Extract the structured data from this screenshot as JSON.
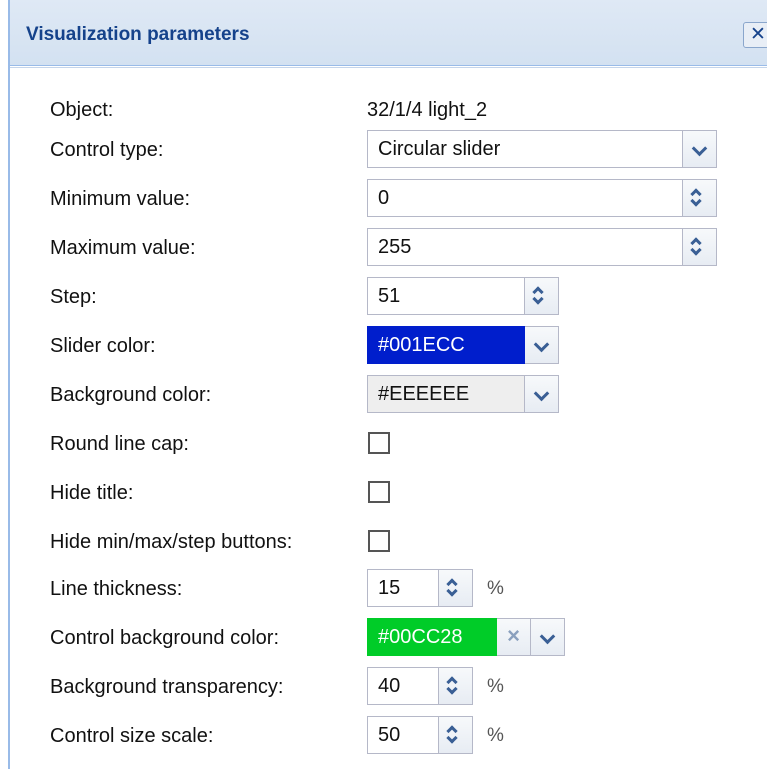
{
  "dialog": {
    "title": "Visualization parameters",
    "close_icon": "close-icon"
  },
  "colors": {
    "title_bar_bg": "#d3e1f1",
    "title_text": "#15428b",
    "slider_color": "#001ECC",
    "background_color": "#EEEEEE",
    "control_background_color": "#00CC28"
  },
  "fields": {
    "object": {
      "label": "Object:",
      "value": "32/1/4 light_2"
    },
    "control_type": {
      "label": "Control type:",
      "value": "Circular slider"
    },
    "minimum_value": {
      "label": "Minimum value:",
      "value": "0"
    },
    "maximum_value": {
      "label": "Maximum value:",
      "value": "255"
    },
    "step": {
      "label": "Step:",
      "value": "51"
    },
    "slider_color": {
      "label": "Slider color:",
      "value": "#001ECC"
    },
    "background_color": {
      "label": "Background color:",
      "value": "#EEEEEE"
    },
    "round_line_cap": {
      "label": "Round line cap:",
      "checked": false
    },
    "hide_title": {
      "label": "Hide title:",
      "checked": false
    },
    "hide_buttons": {
      "label": "Hide min/max/step buttons:",
      "checked": false
    },
    "line_thickness": {
      "label": "Line thickness:",
      "value": "15",
      "unit": "%"
    },
    "control_background_color": {
      "label": "Control background color:",
      "value": "#00CC28",
      "clear_glyph": "×"
    },
    "background_transparency": {
      "label": "Background transparency:",
      "value": "40",
      "unit": "%"
    },
    "control_size_scale": {
      "label": "Control size scale:",
      "value": "50",
      "unit": "%"
    }
  }
}
